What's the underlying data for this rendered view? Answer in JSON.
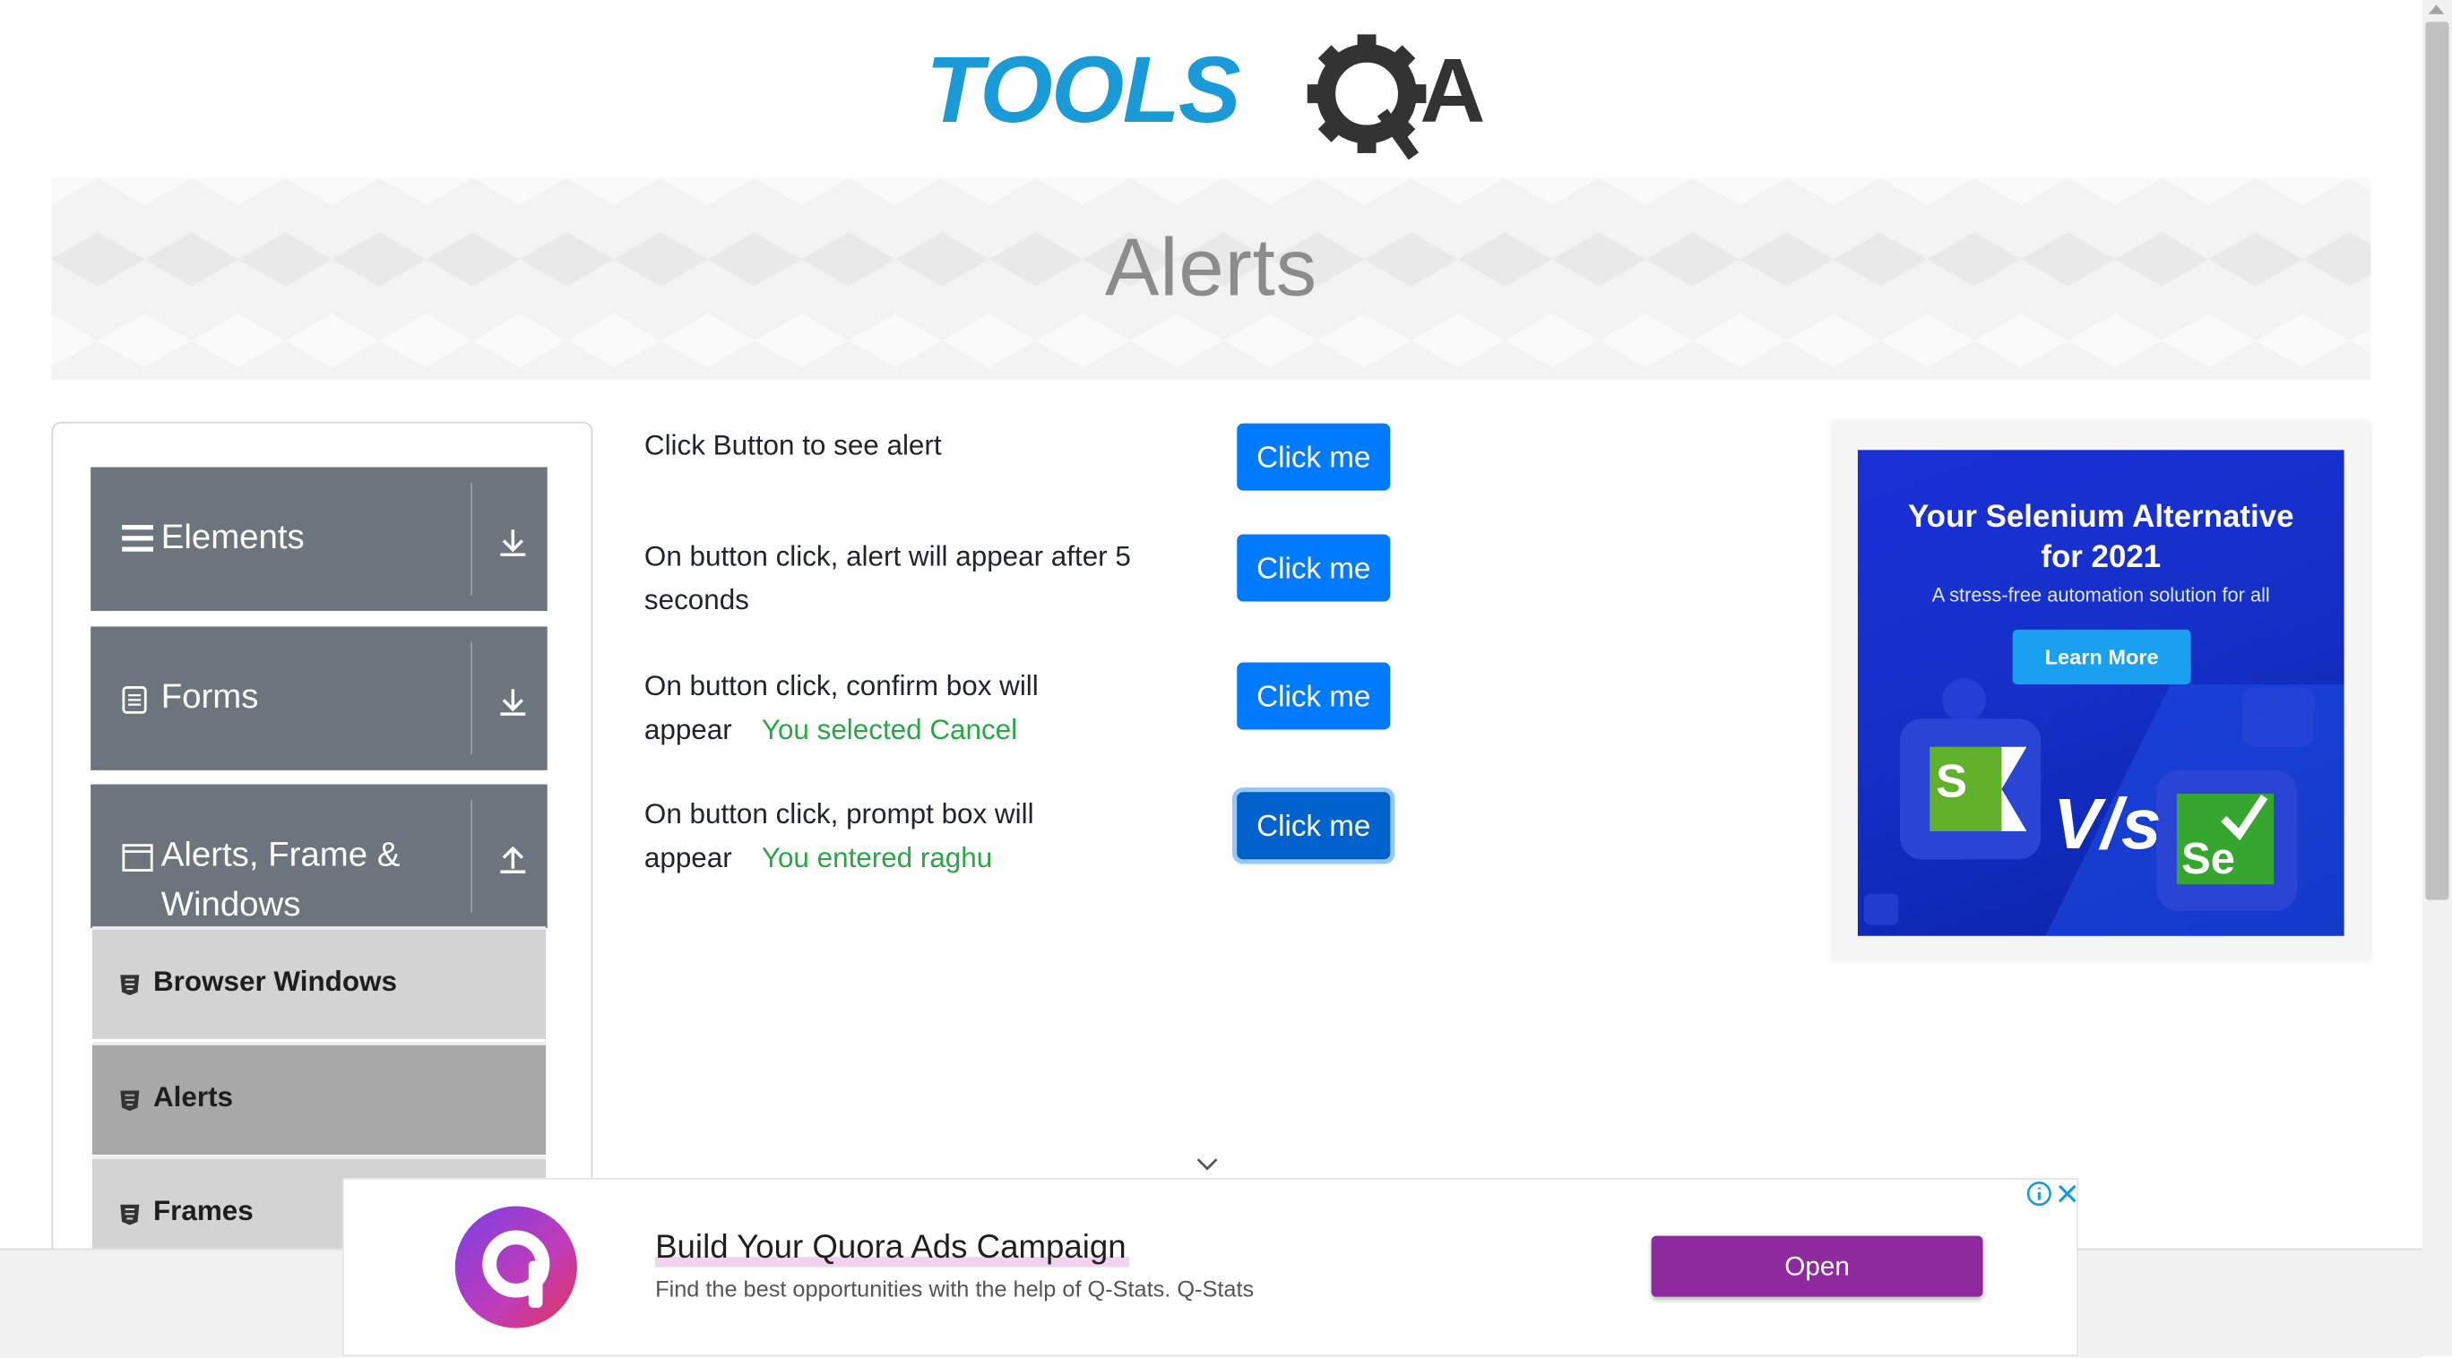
{
  "logo": {
    "text_tools": "TOOLS",
    "text_q": "Q",
    "text_a": "A"
  },
  "banner": {
    "title": "Alerts"
  },
  "sidebar": {
    "groups": [
      {
        "label": "Elements",
        "icon": "hamburger-icon",
        "arrow": "download-arrow-icon"
      },
      {
        "label": "Forms",
        "icon": "document-icon",
        "arrow": "download-arrow-icon"
      },
      {
        "label_line1": "Alerts, Frame &",
        "label_line2": "Windows",
        "icon": "window-icon",
        "arrow": "upload-arrow-icon"
      }
    ],
    "items": [
      {
        "label": "Browser Windows",
        "active": false
      },
      {
        "label": "Alerts",
        "active": true
      },
      {
        "label": "Frames",
        "active": false
      }
    ]
  },
  "main": {
    "rows": [
      {
        "text": "Click Button to see alert",
        "result": "",
        "button": "Click me"
      },
      {
        "text_line1": "On button click, alert will appear after 5",
        "text_line2": "seconds",
        "result": "",
        "button": "Click me"
      },
      {
        "text_line1": "On button click, confirm box will",
        "text_line2": "appear",
        "result": "You selected Cancel",
        "button": "Click me"
      },
      {
        "text_line1": "On button click, prompt box will",
        "text_line2": "appear",
        "result": "You entered raghu",
        "button": "Click me"
      }
    ]
  },
  "right_ad": {
    "title_line1": "Your Selenium Alternative",
    "title_line2": "for 2021",
    "subtitle": "A stress-free automation solution for all",
    "button": "Learn More",
    "vs": "V/s",
    "logo_left": "S",
    "logo_right": "Se"
  },
  "bottom_ad": {
    "title": "Build Your Quora Ads Campaign",
    "description": "Find the best opportunities with the help of Q-Stats. Q-Stats",
    "button": "Open"
  },
  "colors": {
    "primary_button": "#007bff",
    "sidebar_group": "#6c757d",
    "success_text": "#28a745",
    "ad_button": "#8e2a9e"
  }
}
